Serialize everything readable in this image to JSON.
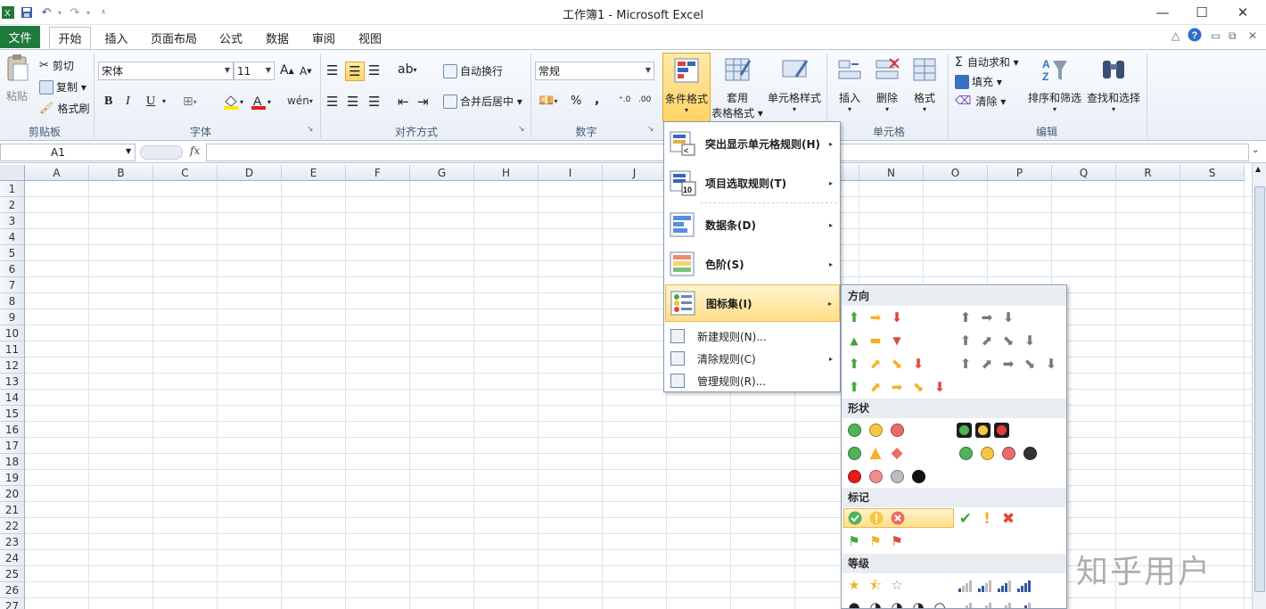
{
  "app": {
    "title": "工作簿1  -  Microsoft Excel",
    "qat_icons": [
      "excel-logo-icon",
      "save-icon",
      "undo-icon",
      "redo-icon",
      "customize-icon"
    ]
  },
  "tabs": {
    "file": "文件",
    "items": [
      "开始",
      "插入",
      "页面布局",
      "公式",
      "数据",
      "审阅",
      "视图"
    ],
    "active": "开始"
  },
  "ribbon": {
    "clipboard": {
      "paste": "粘贴",
      "cut": "剪切",
      "copy": "复制 ▾",
      "format_painter": "格式刷",
      "label": "剪贴板"
    },
    "font": {
      "name": "宋体",
      "size": "11",
      "bold": "B",
      "italic": "I",
      "underline": "U",
      "label": "字体"
    },
    "alignment": {
      "wrap": "自动换行",
      "merge": "合并后居中 ▾",
      "label": "对齐方式"
    },
    "number": {
      "format": "常规",
      "percent": "%",
      "comma": ",",
      "label": "数字"
    },
    "styles": {
      "conditional": "条件格式",
      "table_line1": "套用",
      "table_line2": "表格格式 ▾",
      "cell_styles": "单元格样式"
    },
    "cells": {
      "insert": "插入",
      "delete": "删除",
      "format": "格式",
      "label": "单元格"
    },
    "editing": {
      "autosum": "自动求和 ▾",
      "fill": "填充 ▾",
      "clear": "清除 ▾",
      "sort": "排序和筛选",
      "find": "查找和选择",
      "label": "编辑"
    }
  },
  "formula_bar": {
    "cell_ref": "A1",
    "fx": "fx",
    "value": ""
  },
  "grid": {
    "columns": [
      "A",
      "B",
      "C",
      "D",
      "E",
      "F",
      "G",
      "H",
      "I",
      "J",
      "K",
      "L",
      "M",
      "N",
      "O",
      "P",
      "Q",
      "R",
      "S"
    ],
    "rows": [
      "1",
      "2",
      "3",
      "4",
      "5",
      "6",
      "7",
      "8",
      "9",
      "10",
      "11",
      "12",
      "13",
      "14",
      "15",
      "16",
      "17",
      "18",
      "19",
      "20",
      "21",
      "22",
      "23",
      "24",
      "25",
      "26",
      "27"
    ]
  },
  "cf_menu": {
    "highlight": "突出显示单元格规则(H)",
    "topbottom": "项目选取规则(T)",
    "databar": "数据条(D)",
    "colorscale": "色阶(S)",
    "iconset": "图标集(I)",
    "new_rule": "新建规则(N)...",
    "clear_rules": "清除规则(C)",
    "manage": "管理规则(R)..."
  },
  "iconsets": {
    "directional": "方向",
    "shapes": "形状",
    "indicators": "标记",
    "ratings": "等级"
  },
  "colors": {
    "file_tab": "#217a3d",
    "hover": "#ffdf88",
    "green": "#3fa83a",
    "yellow": "#f3c12a",
    "red": "#e04a3c"
  },
  "watermark": "知乎用户"
}
